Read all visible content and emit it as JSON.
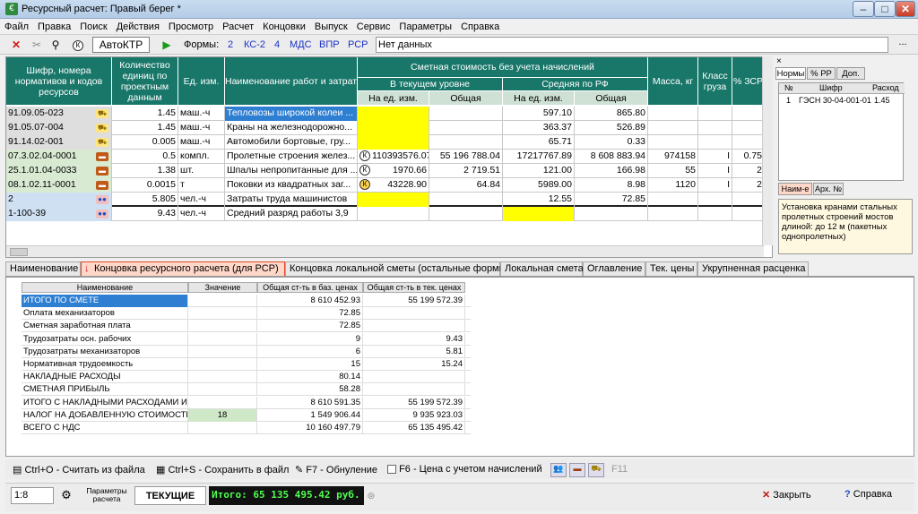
{
  "window": {
    "title": "Ресурсный расчет: Правый берег *"
  },
  "menu": [
    "Файл",
    "Правка",
    "Поиск",
    "Действия",
    "Просмотр",
    "Расчет",
    "Концовки",
    "Выпуск",
    "Сервис",
    "Параметры",
    "Справка"
  ],
  "toolbar": {
    "avtoktr": "АвтоКТР",
    "forms_label": "Формы:",
    "forms": [
      "2",
      "КС-2",
      "4",
      "МДС",
      "ВПР",
      "РСР"
    ],
    "status_text": "Нет данных",
    "dots": "..."
  },
  "grid": {
    "headers": {
      "code": "Шифр, номера нормативов и кодов ресурсов",
      "qty": "Количество единиц по проектным данным",
      "unit": "Ед. изм.",
      "name": "Наименование работ и затрат",
      "cost": "Сметная стоимость без учета начислений",
      "current": "В текущем уровне",
      "avg": "Средняя по РФ",
      "per_unit1": "На ед. изм.",
      "total1": "Общая",
      "per_unit2": "На ед. изм.",
      "total2": "Общая",
      "mass": "Масса, кг",
      "cargo": "Класс груза",
      "zsr": "% ЗСР"
    },
    "rows": [
      {
        "code": "91.09.05-023",
        "qty": "1.45",
        "unit": "маш.-ч",
        "name": "Тепловозы широкой колеи ...",
        "cur_unit": "",
        "cur_total": "",
        "avg_unit": "597.10",
        "avg_total": "865.80",
        "mass": "",
        "cargo": "",
        "zsr": "",
        "icon": "truck-icon",
        "mark": ""
      },
      {
        "code": "91.05.07-004",
        "qty": "1.45",
        "unit": "маш.-ч",
        "name": "Краны на железнодорожно...",
        "cur_unit": "",
        "cur_total": "",
        "avg_unit": "363.37",
        "avg_total": "526.89",
        "mass": "",
        "cargo": "",
        "zsr": "",
        "icon": "truck-icon",
        "mark": ""
      },
      {
        "code": "91.14.02-001",
        "qty": "0.005",
        "unit": "маш.-ч",
        "name": "Автомобили бортовые, гру...",
        "cur_unit": "",
        "cur_total": "",
        "avg_unit": "65.71",
        "avg_total": "0.33",
        "mass": "",
        "cargo": "",
        "zsr": "",
        "icon": "truck-icon",
        "mark": ""
      },
      {
        "code": "07.3.02.04-0001",
        "qty": "0.5",
        "unit": "компл.",
        "name": "Пролетные строения желез...",
        "cur_unit": "110393576.07",
        "cur_total": "55 196 788.04",
        "avg_unit": "17217767.89",
        "avg_total": "8 608 883.94",
        "mass": "974158",
        "cargo": "I",
        "zsr": "0.75",
        "icon": "bricks-icon",
        "mark": "К"
      },
      {
        "code": "25.1.01.04-0033",
        "qty": "1.38",
        "unit": "шт.",
        "name": "Шпалы непропитанные для ...",
        "cur_unit": "1970.66",
        "cur_total": "2 719.51",
        "avg_unit": "121.00",
        "avg_total": "166.98",
        "mass": "55",
        "cargo": "I",
        "zsr": "2",
        "icon": "bricks-icon",
        "mark": "К"
      },
      {
        "code": "08.1.02.11-0001",
        "qty": "0.0015",
        "unit": "т",
        "name": "Поковки из квадратных заг...",
        "cur_unit": "43228.90",
        "cur_total": "64.84",
        "avg_unit": "5989.00",
        "avg_total": "8.98",
        "mass": "1120",
        "cargo": "I",
        "zsr": "2",
        "icon": "bricks-icon",
        "mark": "К"
      },
      {
        "code": "2",
        "qty": "5.805",
        "unit": "чел.-ч",
        "name": "Затраты труда машинистов",
        "cur_unit": "",
        "cur_total": "",
        "avg_unit": "12.55",
        "avg_total": "72.85",
        "mass": "",
        "cargo": "",
        "zsr": "",
        "icon": "people-icon",
        "mark": ""
      },
      {
        "code": "1-100-39",
        "qty": "9.43",
        "unit": "чел.-ч",
        "name": "Средний разряд работы 3,9",
        "cur_unit": "",
        "cur_total": "",
        "avg_unit": "",
        "avg_total": "",
        "mass": "",
        "cargo": "",
        "zsr": "",
        "icon": "people-icon",
        "mark": ""
      }
    ]
  },
  "right_panel": {
    "close": "×",
    "tabs": [
      "Нормы",
      "% РР",
      "Доп."
    ],
    "table_headers": [
      "№",
      "Шифр",
      "Расход"
    ],
    "table_rows": [
      {
        "n": "1",
        "code": "ГЭСН 30-04-001-01",
        "rate": "1.45"
      }
    ],
    "bottom_tabs": [
      "Наим-е",
      "Арх. №"
    ],
    "note": "Установка кранами стальных пролетных строений мостов длиной: до 12 м (пакетных однопролетных)"
  },
  "tabs": [
    "Наименование",
    "Концовка ресурсного расчета (для РСР)",
    "Концовка локальной сметы (остальные формы)",
    "Локальная смета",
    "Оглавление",
    "Тек. цены",
    "Укрупненная расценка"
  ],
  "summary": {
    "headers": [
      "Наименование",
      "Значение",
      "Общая ст-ть в баз. ценах",
      "Общая ст-ть в тек. ценах"
    ],
    "rows": [
      {
        "name": "ИТОГО ПО СМЕТЕ",
        "value": "",
        "base": "8 610 452.93",
        "cur": "55 199 572.39"
      },
      {
        "name": "Оплата механизаторов",
        "value": "",
        "base": "72.85",
        "cur": ""
      },
      {
        "name": "Сметная заработная плата",
        "value": "",
        "base": "72.85",
        "cur": ""
      },
      {
        "name": "Трудозатраты осн. рабочих",
        "value": "",
        "base": "9",
        "cur": "9.43"
      },
      {
        "name": "Трудозатраты механизаторов",
        "value": "",
        "base": "6",
        "cur": "5.81"
      },
      {
        "name": "Нормативная трудоемкость",
        "value": "",
        "base": "15",
        "cur": "15.24"
      },
      {
        "name": "НАКЛАДНЫЕ РАСХОДЫ",
        "value": "",
        "base": "80.14",
        "cur": ""
      },
      {
        "name": "СМЕТНАЯ ПРИБЫЛЬ",
        "value": "",
        "base": "58.28",
        "cur": ""
      },
      {
        "name": "ИТОГО С НАКЛАДНЫМИ РАСХОДАМИ И СМЕТ",
        "value": "",
        "base": "8 610 591.35",
        "cur": "55 199 572.39"
      },
      {
        "name": "НАЛОГ НА ДОБАВЛЕННУЮ СТОИМОСТЬ (НДС",
        "value": "18",
        "base": "1 549 906.44",
        "cur": "9 935 923.03"
      },
      {
        "name": "ВСЕГО С НДС",
        "value": "",
        "base": "10 160 497.79",
        "cur": "65 135 495.42"
      }
    ]
  },
  "hotkeys": {
    "open": "Ctrl+O - Считать из файла",
    "save": "Ctrl+S - Сохранить в файл",
    "reset": "F7 - Обнуление",
    "prices": "F6 - Цена с учетом начислений",
    "f11": "F11"
  },
  "status": {
    "page": "1:8",
    "params": "Параметры расчета",
    "current": "ТЕКУЩИЕ",
    "total": "Итого: 65 135 495.42 руб.",
    "close": "Закрыть",
    "help": "Справка"
  },
  "colors": {
    "header_teal": "#19776a",
    "selection": "#2e7fd2",
    "highlight": "#ffff00",
    "total_text": "#4fff4f",
    "link": "#1a30c8"
  }
}
